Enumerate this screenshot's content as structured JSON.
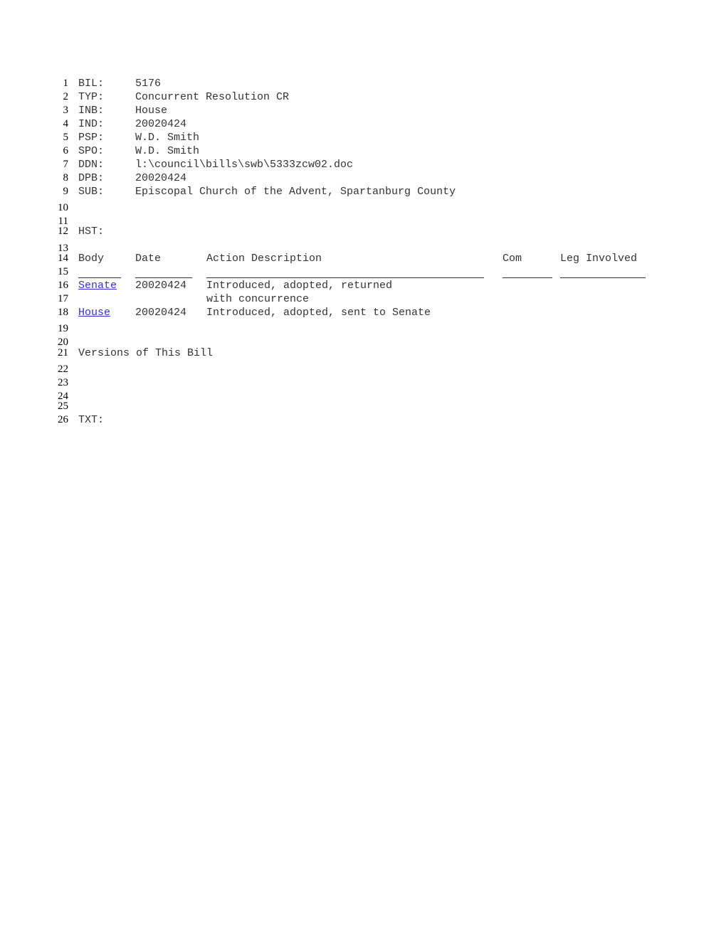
{
  "fields": [
    {
      "num": "1",
      "key": "BIL:",
      "value": "5176"
    },
    {
      "num": "2",
      "key": "TYP:",
      "value": "Concurrent Resolution CR"
    },
    {
      "num": "3",
      "key": "INB:",
      "value": "House"
    },
    {
      "num": "4",
      "key": "IND:",
      "value": "20020424"
    },
    {
      "num": "5",
      "key": "PSP:",
      "value": "W.D. Smith"
    },
    {
      "num": "6",
      "key": "SPO:",
      "value": "W.D. Smith"
    },
    {
      "num": "7",
      "key": "DDN:",
      "value": "l:\\council\\bills\\swb\\5333zcw02.doc"
    },
    {
      "num": "8",
      "key": "DPB:",
      "value": "20020424"
    },
    {
      "num": "9",
      "key": "SUB:",
      "value": "Episcopal Church of the Advent, Spartanburg County"
    }
  ],
  "line_numbers": {
    "l10": "10",
    "l11": "11",
    "l12": "12",
    "l13": "13",
    "l14": "14",
    "l15": "15",
    "l16": "16",
    "l17": "17",
    "l18": "18",
    "l19": "19",
    "l20": "20",
    "l21": "21",
    "l22": "22",
    "l23": "23",
    "l24": "24",
    "l25": "25",
    "l26": "26"
  },
  "history": {
    "label": "HST:",
    "headers": {
      "body": "Body",
      "date": "Date",
      "action": "Action Description",
      "com": "Com",
      "leg": "Leg Involved"
    },
    "rows": [
      {
        "body": "Senate",
        "date": "20020424",
        "action": "Introduced, adopted, returned",
        "action_cont": "with concurrence"
      },
      {
        "body": "House",
        "date": "20020424",
        "action": "Introduced, adopted, sent to Senate"
      }
    ]
  },
  "versions_label": "Versions of This Bill",
  "txt_label": "TXT:",
  "colors": {
    "link": "#3333cc",
    "text": "#333333"
  }
}
